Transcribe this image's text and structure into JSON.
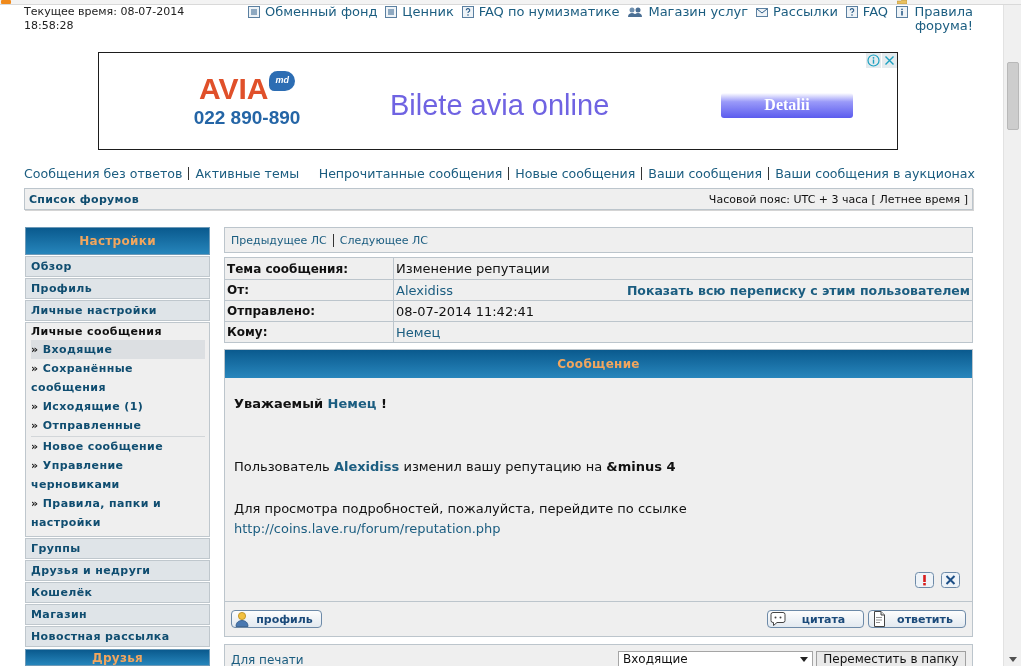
{
  "top_nav": {
    "clock": [
      "Текущее время: 08-07-2014",
      "18:58:28"
    ],
    "links": [
      {
        "label": "Обменный фонд",
        "kind": "list"
      },
      {
        "label": "Ценник",
        "kind": "list"
      },
      {
        "label": "FAQ по нумизматике",
        "kind": "faq"
      },
      {
        "label": "Магазин услуг",
        "kind": "shop"
      },
      {
        "label": "Рассылки",
        "kind": "mail"
      },
      {
        "label": "FAQ",
        "kind": "faq"
      },
      {
        "label": "Правила форума!",
        "kind": "rules"
      }
    ]
  },
  "ad": {
    "logo": "AVIA",
    "logo_badge": "md",
    "phone": "022 890-890",
    "headline": "Bilete avia online",
    "button": "Detalii"
  },
  "quick_links": {
    "left": [
      "Сообщения без ответов",
      "Активные темы"
    ],
    "right": [
      "Непрочитанные сообщения",
      "Новые сообщения",
      "Ваши сообщения",
      "Ваши сообщения в аукционах"
    ]
  },
  "breadcrumb": {
    "link": "Список форумов",
    "timezone": "Часовой пояс: UTC + 3 часа [ Летнее время ]"
  },
  "sidebar": {
    "title": "Настройки",
    "items": [
      {
        "label": "Обзор",
        "kind": "link"
      },
      {
        "label": "Профиль",
        "kind": "link"
      },
      {
        "label": "Личные настройки",
        "kind": "link"
      },
      {
        "label": "Личные сообщения",
        "kind": "section",
        "groups": [
          [
            {
              "bullet": "»",
              "label": "Входящие",
              "selected": true
            },
            {
              "bullet": "»",
              "label": "Сохранённые сообщения",
              "selected": false
            },
            {
              "bullet": "»",
              "label": "Исходящие (1)",
              "selected": false
            },
            {
              "bullet": "»",
              "label": "Отправленные",
              "selected": false
            }
          ],
          [
            {
              "bullet": "»",
              "label": "Новое сообщение",
              "selected": false
            },
            {
              "bullet": "»",
              "label": "Управление черновиками",
              "selected": false
            },
            {
              "bullet": "»",
              "label": "Правила, папки и настройки",
              "selected": false
            }
          ]
        ]
      },
      {
        "label": "Группы",
        "kind": "link"
      },
      {
        "label": "Друзья и недруги",
        "kind": "link"
      },
      {
        "label": "Кошелёк",
        "kind": "link"
      },
      {
        "label": "Магазин",
        "kind": "link"
      },
      {
        "label": "Новостная рассылка",
        "kind": "link"
      }
    ],
    "next_panel": "Друзья"
  },
  "pager": {
    "previous": "Предыдущее ЛС",
    "next": "Следующее ЛС"
  },
  "message_info": [
    {
      "label": "Тема сообщения:",
      "value": "Изменение репутации",
      "kind": "text"
    },
    {
      "label": "От:",
      "value": "Alexidiss",
      "kind": "link",
      "action": "Показать всю переписку с этим пользователем"
    },
    {
      "label": "Отправлено:",
      "value": "08-07-2014 11:42:41",
      "kind": "text"
    },
    {
      "label": "Кому:",
      "value": "Немец",
      "kind": "link"
    }
  ],
  "message": {
    "title": "Сообщение",
    "paragraphs": [
      {
        "kind": "greeting",
        "parts": [
          {
            "kind": "text",
            "text": "Уважаемый "
          },
          {
            "kind": "user",
            "text": "Немец"
          },
          {
            "kind": "text",
            "text": " !"
          }
        ]
      },
      {
        "kind": "body",
        "parts": [
          {
            "kind": "text",
            "text": "Пользователь "
          },
          {
            "kind": "user",
            "text": "Alexidiss"
          },
          {
            "kind": "text",
            "text": " изменил вашу репутацию на **&minus 4**"
          }
        ]
      },
      {
        "kind": "body",
        "parts": [
          {
            "kind": "text",
            "text": "Для просмотра подробностей, пожалуйста, перейдите по ссылке"
          },
          {
            "kind": "url",
            "text": "http://coins.lave.ru/forum/reputation.php"
          }
        ]
      }
    ],
    "buttons": [
      {
        "label": "профиль",
        "kind": "profile"
      },
      {
        "label": "цитата",
        "kind": "quote"
      },
      {
        "label": "ответить",
        "kind": "reply"
      }
    ]
  },
  "footer": {
    "print_link": "Для печати",
    "folder_select": {
      "value": "Входящие"
    },
    "move_button": "Переместить в папку"
  }
}
